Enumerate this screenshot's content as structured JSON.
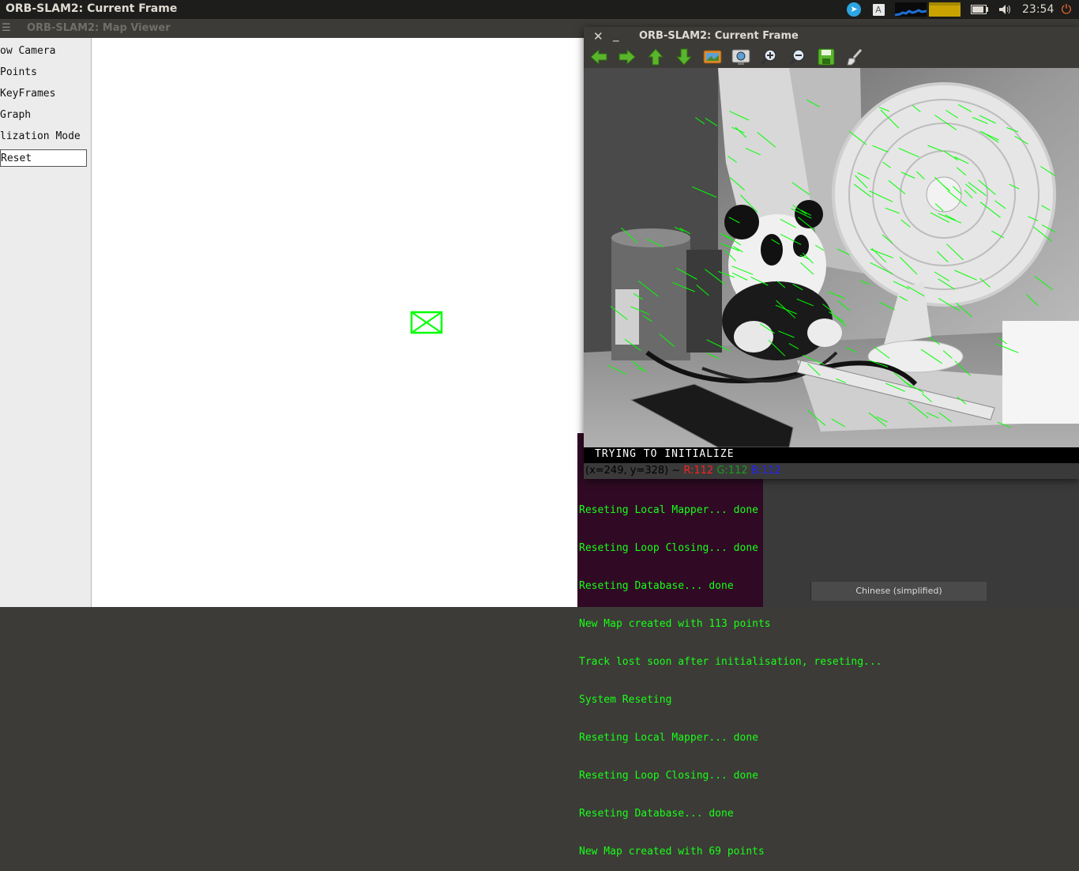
{
  "topbar": {
    "title": "ORB-SLAM2: Current Frame",
    "clock": "23:54",
    "keyboard_indicator": "A",
    "icons": [
      "telegram-icon",
      "keyboard-icon",
      "network-monitor-icon",
      "cpu-monitor-icon",
      "battery-icon",
      "volume-icon",
      "power-icon"
    ]
  },
  "map_viewer": {
    "title": "ORB-SLAM2: Map Viewer",
    "menu": [
      {
        "label": "ow Camera"
      },
      {
        "label": " Points"
      },
      {
        "label": " KeyFrames"
      },
      {
        "label": " Graph"
      },
      {
        "label": "lization Mode"
      },
      {
        "label": " Reset"
      }
    ]
  },
  "current_frame": {
    "title": "ORB-SLAM2: Current Frame",
    "toolbar": [
      "arrow-left-icon",
      "arrow-right-icon",
      "arrow-up-icon",
      "arrow-down-icon",
      "image-icon",
      "fit-window-icon",
      "zoom-in-icon",
      "zoom-out-icon",
      "save-icon",
      "brush-icon"
    ],
    "status_text": "TRYING TO INITIALIZE",
    "pixel_info": {
      "coords": "(x=249, y=328) ~",
      "r": "R:112",
      "g": "G:112",
      "b": "B:112"
    }
  },
  "terminal": {
    "lines": [
      "Reseting Local Mapper... done",
      "Reseting Loop Closing... done",
      "Reseting Database... done",
      "New Map created with 113 points",
      "Track lost soon after initialisation, reseting...",
      "System Reseting",
      "Reseting Local Mapper... done",
      "Reseting Loop Closing... done",
      "Reseting Database... done",
      "New Map created with 69 points"
    ]
  },
  "ime_status": "Chinese (simplified)"
}
